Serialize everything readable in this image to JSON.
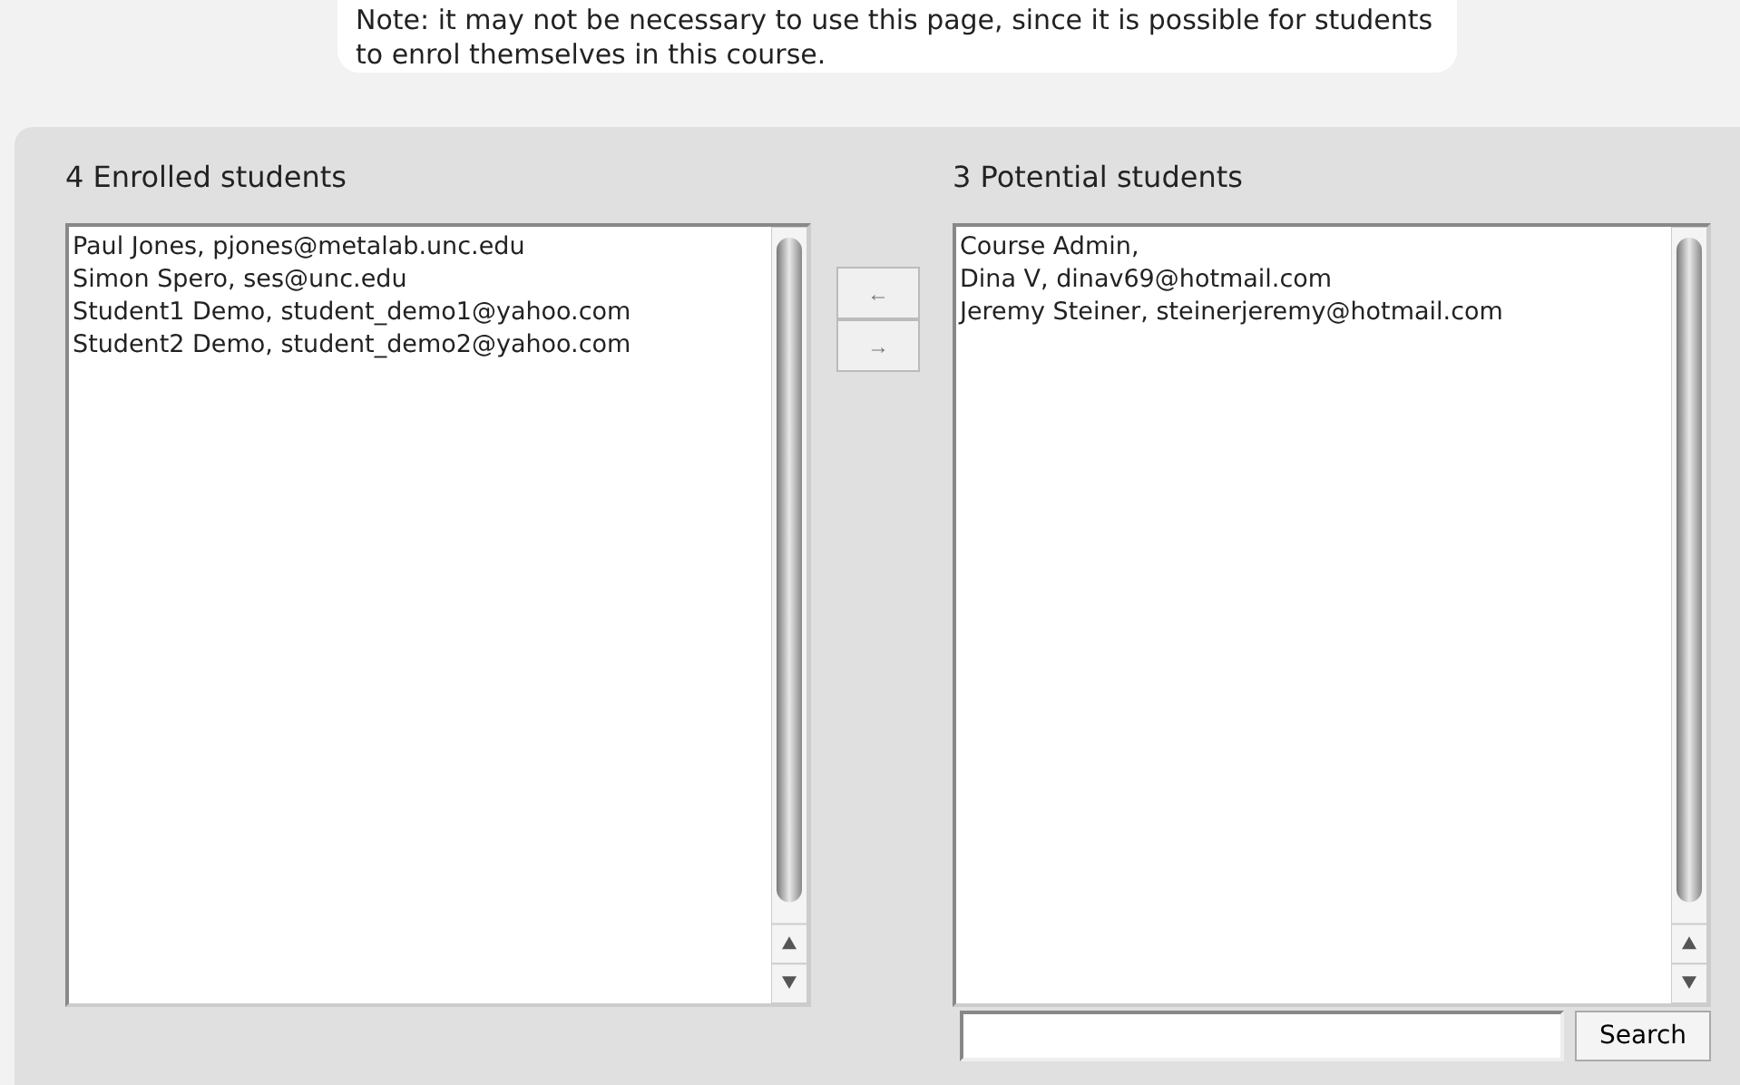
{
  "note": "Note: it may not be necessary to use this page, since it is possible for students to enrol themselves in this course.",
  "enrolled": {
    "heading": "4 Enrolled students",
    "items": [
      "Paul Jones, pjones@metalab.unc.edu",
      "Simon Spero, ses@unc.edu",
      "Student1 Demo, student_demo1@yahoo.com",
      "Student2 Demo, student_demo2@yahoo.com"
    ]
  },
  "move_buttons": [
    "←",
    "→"
  ],
  "potential": {
    "heading": "3 Potential students",
    "items": [
      "Course Admin,",
      "Dina V, dinav69@hotmail.com",
      "Jeremy Steiner, steinerjeremy@hotmail.com"
    ]
  },
  "search": {
    "button": "Search"
  }
}
